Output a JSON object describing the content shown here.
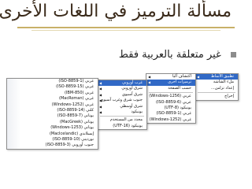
{
  "title": "مسألة الترميز في اللغات الأخرى",
  "bullet_text": "غير متعلقة بالعربية فقط",
  "menu_main": {
    "items": [
      {
        "label": "تطبيق الأنماط",
        "highlighted": true,
        "has_submenu": true
      },
      {
        "label": "ملء الشاشة",
        "highlighted": false,
        "has_submenu": false
      },
      {
        "label": "إعداد تزامن...",
        "highlighted": false,
        "has_submenu": false
      },
      {
        "label": "إخراج",
        "highlighted": false,
        "has_submenu": false
      }
    ]
  },
  "menu_encoding": {
    "items": [
      {
        "label": "اكتشاف آليا",
        "highlighted": false,
        "has_submenu": true
      },
      {
        "label": "ترميزات أخرى",
        "highlighted": true,
        "has_submenu": true
      },
      {
        "label": "حسب الصفحة",
        "highlighted": false,
        "has_submenu": false
      },
      {
        "label": "عربي (Windows-1256)",
        "highlighted": false,
        "has_submenu": false
      },
      {
        "label": "عربي (ISO-8859-6)",
        "highlighted": false,
        "has_submenu": false
      },
      {
        "label": "يونيكود (UTF-8)",
        "highlighted": false,
        "has_submenu": false
      },
      {
        "label": "غربي (ISO-8859-1)",
        "highlighted": false,
        "has_submenu": false
      },
      {
        "label": "غربي (Windows-1252)",
        "highlighted": false,
        "has_submenu": false
      }
    ]
  },
  "menu_regions": {
    "items": [
      {
        "label": "غرب أوروبي",
        "highlighted": true,
        "has_submenu": true
      },
      {
        "label": "شرق أوروبي",
        "highlighted": false,
        "has_submenu": true
      },
      {
        "label": "شرق آسيوي",
        "highlighted": false,
        "has_submenu": true
      },
      {
        "label": "جنوب شرق وغرب آسيوي",
        "highlighted": false,
        "has_submenu": true
      },
      {
        "label": "شرق أوسطي",
        "highlighted": false,
        "has_submenu": true
      },
      {
        "label": "يونيكود",
        "highlighted": false,
        "has_submenu": true
      },
      {
        "label": "محدد من المستخدم",
        "highlighted": false,
        "has_submenu": false
      },
      {
        "label": "يونيكود (UTF-16)",
        "highlighted": false,
        "has_submenu": false
      }
    ]
  },
  "menu_western": {
    "items": [
      {
        "label": "غربي (ISO-8859-1)"
      },
      {
        "label": "غربي (ISO-8859-15)"
      },
      {
        "label": "غربي (IBM-850)"
      },
      {
        "label": "غربي (MacRoman)"
      },
      {
        "label": "غربي (Windows-1252)"
      },
      {
        "label": "كلتي (ISO-8859-14)"
      },
      {
        "label": "يوناني (ISO-8859-7)"
      },
      {
        "label": "يوناني (MacGreek)"
      },
      {
        "label": "يوناني (Windows-1253)"
      },
      {
        "label": "إيسلاندي (MacIcelandic)"
      },
      {
        "label": "نورديني (ISO-8859-10)"
      },
      {
        "label": "جنوب أوروبي (ISO-8859-3)"
      }
    ]
  }
}
